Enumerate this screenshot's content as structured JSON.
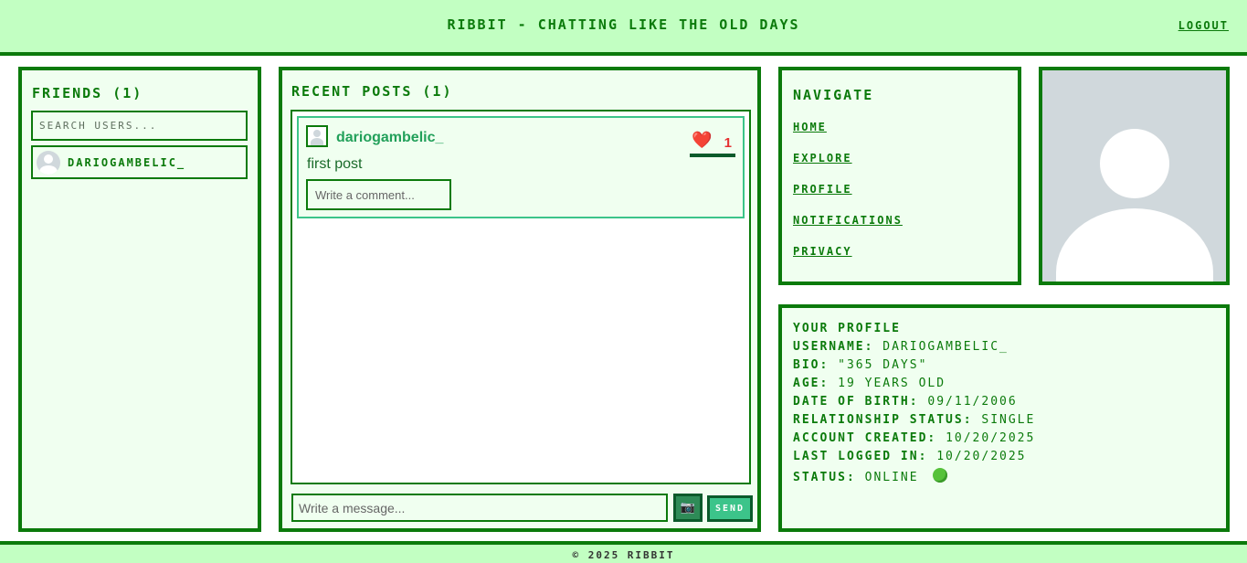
{
  "header": {
    "title": "RIBBIT - CHATTING LIKE THE OLD DAYS",
    "logout_label": "LOGOUT"
  },
  "friends": {
    "title": "FRIENDS (1)",
    "search_placeholder": "SEARCH USERS...",
    "items": [
      {
        "name": "DARIOGAMBELIC_"
      }
    ]
  },
  "posts": {
    "title": "RECENT POSTS (1)",
    "items": [
      {
        "username": "dariogambelic_",
        "text": "first post",
        "likes": "1",
        "like_icon": "heart-icon",
        "comment_placeholder": "Write a comment..."
      }
    ],
    "message_placeholder": "Write a message...",
    "camera_icon": "📷",
    "send_label": "SEND"
  },
  "navigate": {
    "title": "NAVIGATE",
    "links": [
      "HOME",
      "EXPLORE",
      "PROFILE",
      "NOTIFICATIONS",
      "PRIVACY"
    ]
  },
  "profile": {
    "title": "YOUR PROFILE",
    "username_label": "USERNAME:",
    "username": "DARIOGAMBELIC_",
    "bio_label": "BIO:",
    "bio": "\"365 DAYS\"",
    "age_label": "AGE:",
    "age": "19 YEARS OLD",
    "dob_label": "DATE OF BIRTH:",
    "dob": "09/11/2006",
    "relationship_label": "RELATIONSHIP STATUS:",
    "relationship": "SINGLE",
    "created_label": "ACCOUNT CREATED:",
    "created": "10/20/2025",
    "last_login_label": "LAST LOGGED IN:",
    "last_login": "10/20/2025",
    "status_label": "STATUS:",
    "status": "ONLINE",
    "status_color": "#56c23a"
  },
  "footer": {
    "text": "© 2025 RIBBIT"
  },
  "colors": {
    "accent": "#0b7a0b",
    "header_bg": "#c2ffc2",
    "panel_bg": "#f0fff0",
    "like_color": "#e53030"
  }
}
